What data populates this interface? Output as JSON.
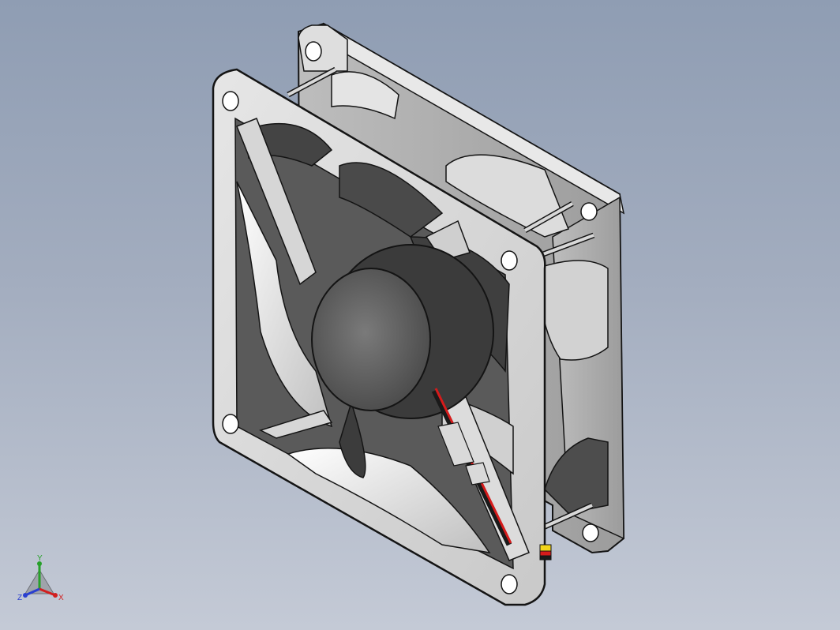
{
  "viewport": {
    "background_top": "#8f9db3",
    "background_bottom": "#c4cad6"
  },
  "model": {
    "icon": "axial-cooling-fan-3d-model",
    "body_color": "#d9d9d9",
    "edge_color": "#141414",
    "wire_colors": {
      "red": "#d61b1b",
      "black": "#1a1a1a",
      "yellow": "#f2d51a"
    }
  },
  "triad": {
    "icon": "view-orientation-triad-icon",
    "x_label": "X",
    "y_label": "Y",
    "z_label": "Z",
    "colors": {
      "x": "#d21f1f",
      "y": "#27a02a",
      "z": "#2a3fd0"
    }
  }
}
